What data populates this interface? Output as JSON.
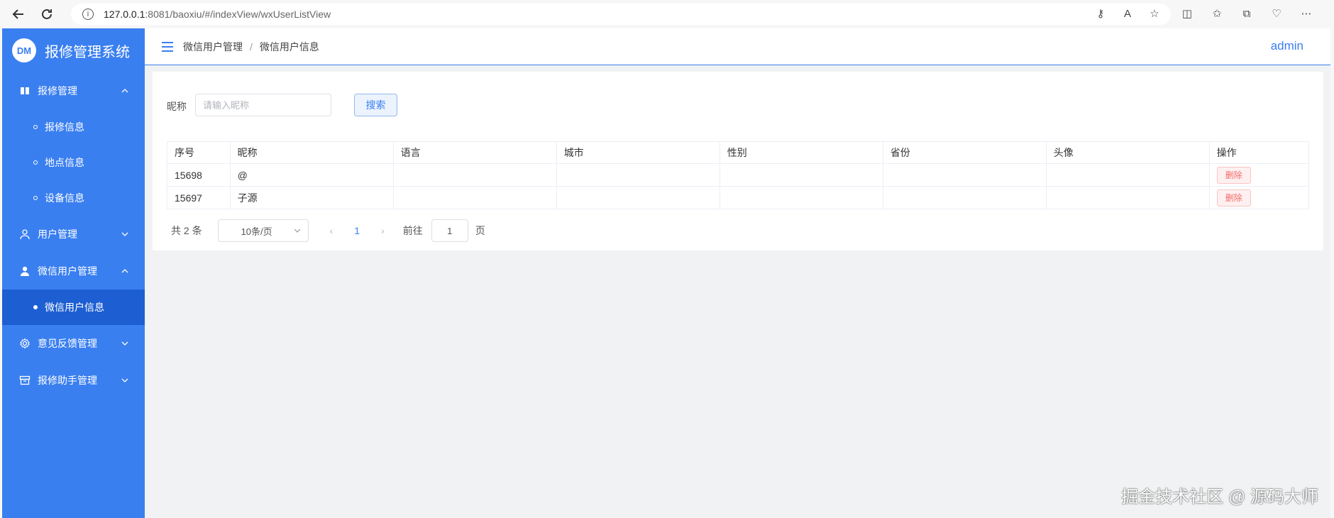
{
  "browser": {
    "url_host": "127.0.0.1",
    "url_rest": ":8081/baoxiu/#/indexView/wxUserListView"
  },
  "sidebar": {
    "logo_text": "DM",
    "app_title": "报修管理系统",
    "menus": [
      {
        "label": "报修管理",
        "icon": "book-icon",
        "expanded": true,
        "items": [
          "报修信息",
          "地点信息",
          "设备信息"
        ]
      },
      {
        "label": "用户管理",
        "icon": "user-icon",
        "expanded": false,
        "items": []
      },
      {
        "label": "微信用户管理",
        "icon": "person-icon",
        "expanded": true,
        "items": [
          "微信用户信息"
        ]
      },
      {
        "label": "意见反馈管理",
        "icon": "gear-icon",
        "expanded": false,
        "items": []
      },
      {
        "label": "报修助手管理",
        "icon": "box-icon",
        "expanded": false,
        "items": []
      }
    ]
  },
  "header": {
    "breadcrumb_parent": "微信用户管理",
    "breadcrumb_current": "微信用户信息",
    "user": "admin"
  },
  "search": {
    "label": "昵称",
    "placeholder": "请输入昵称",
    "button": "搜索"
  },
  "table": {
    "columns": [
      "序号",
      "昵称",
      "语言",
      "城市",
      "性别",
      "省份",
      "头像",
      "操作"
    ],
    "rows": [
      {
        "id": "15698",
        "nickname": "@",
        "language": "",
        "city": "",
        "gender": "",
        "province": "",
        "avatar": "",
        "action": "删除"
      },
      {
        "id": "15697",
        "nickname": "子源",
        "language": "",
        "city": "",
        "gender": "",
        "province": "",
        "avatar": "",
        "action": "删除"
      }
    ]
  },
  "pager": {
    "total": "共 2 条",
    "page_size": "10条/页",
    "current_page": "1",
    "goto_label": "前往",
    "goto_value": "1",
    "page_word": "页"
  },
  "watermark": "掘金技术社区 @ 源码大师",
  "colors": {
    "primary": "#3a7ff0",
    "sidebar_active": "#1d5fd3",
    "danger": "#f56c6c"
  }
}
